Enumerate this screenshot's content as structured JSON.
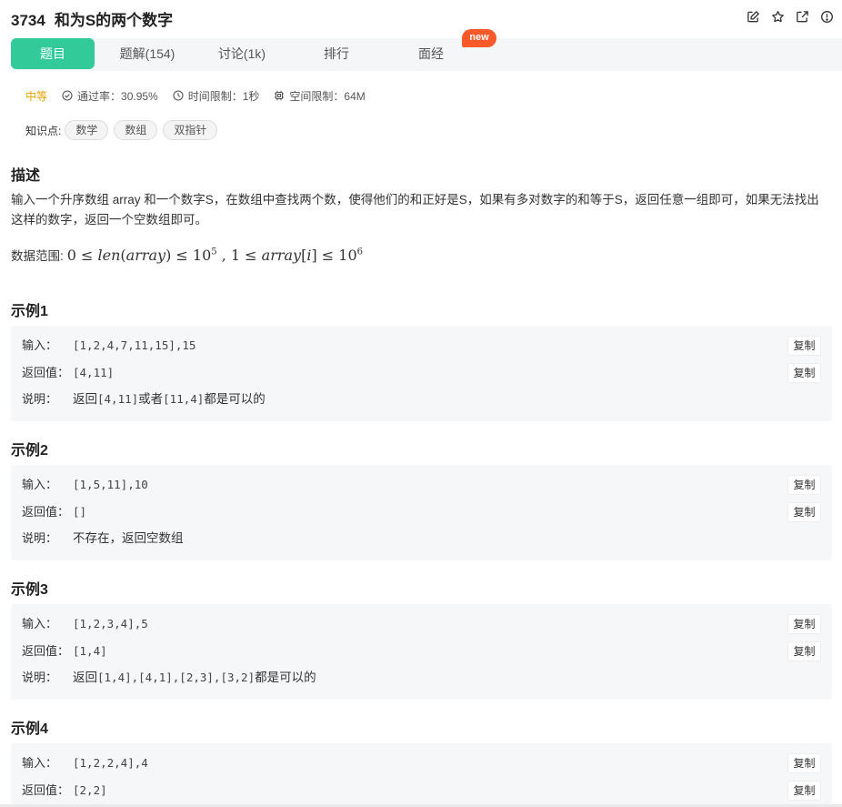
{
  "header": {
    "problem_number": "3734",
    "problem_title": "和为S的两个数字",
    "icons": [
      "edit-icon",
      "star-icon",
      "share-icon",
      "info-icon"
    ]
  },
  "tabs": [
    {
      "label": "题目",
      "active": true
    },
    {
      "label": "题解(154)",
      "active": false
    },
    {
      "label": "讨论(1k)",
      "active": false
    },
    {
      "label": "排行",
      "active": false
    },
    {
      "label": "面经",
      "active": false
    }
  ],
  "new_badge": "new",
  "meta": {
    "difficulty": "中等",
    "pass_rate": "通过率：30.95%",
    "time_limit": "时间限制：1秒",
    "space_limit": "空间限制：64M"
  },
  "knowledge": {
    "label": "知识点:",
    "tags": [
      "数学",
      "数组",
      "双指针"
    ]
  },
  "description": {
    "heading": "描述",
    "text": "输入一个升序数组 array 和一个数字S，在数组中查找两个数，使得他们的和正好是S，如果有多对数字的和等于S，返回任意一组即可，如果无法找出这样的数字，返回一个空数组即可。",
    "range_label": "数据范围:",
    "range_parts": {
      "a": "0 ≤ ",
      "b": "len",
      "c": "(",
      "d": "array",
      "e": ") ≤ 10",
      "f": "5",
      "g": " ,  1 ≤ ",
      "h": "array",
      "i": "[",
      "j": "i",
      "k": "] ≤ 10",
      "l": "6"
    }
  },
  "labels": {
    "input": "输入：",
    "output": "返回值：",
    "explain": "说明：",
    "copy": "复制"
  },
  "examples": [
    {
      "title": "示例1",
      "input": "[1,2,4,7,11,15],15",
      "output": "[4,11]",
      "explain_parts": [
        "返回",
        "[4,11]",
        "或者",
        "[11,4]",
        "都是可以的"
      ]
    },
    {
      "title": "示例2",
      "input": "[1,5,11],10",
      "output": "[]",
      "explain_parts": [
        "不存在，返回空数组"
      ]
    },
    {
      "title": "示例3",
      "input": "[1,2,3,4],5",
      "output": "[1,4]",
      "explain_parts": [
        "返回",
        "[1,4],[4,1],[2,3],[3,2]",
        "都是可以的"
      ]
    },
    {
      "title": "示例4",
      "input": "[1,2,2,4],4",
      "output": "[2,2]"
    }
  ],
  "colors": {
    "accent": "#32ca99",
    "badge": "#fa5a2a",
    "difficulty": "#e8a300"
  }
}
